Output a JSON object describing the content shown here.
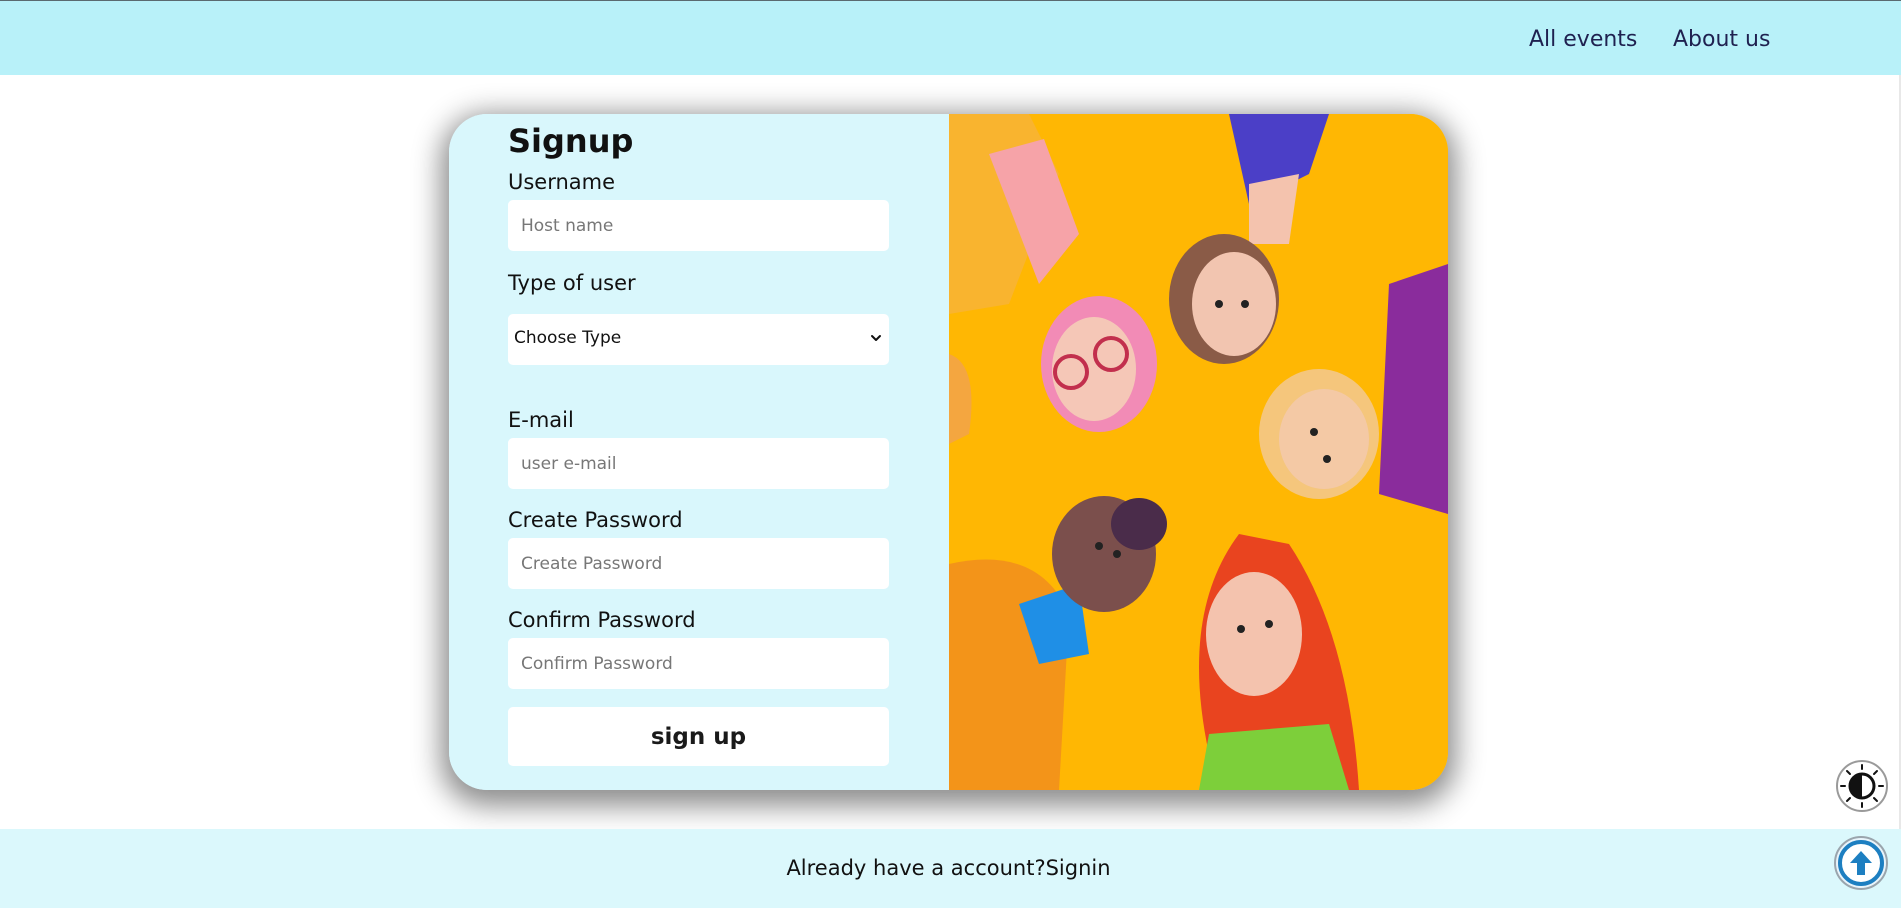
{
  "header": {
    "nav": [
      {
        "label": "All events"
      },
      {
        "label": "About us"
      }
    ]
  },
  "form": {
    "title": "Signup",
    "username": {
      "label": "Username",
      "placeholder": "Host name",
      "value": ""
    },
    "user_type": {
      "label": "Type of user",
      "selected": "Choose Type"
    },
    "email": {
      "label": "E-mail",
      "placeholder": "user e-mail",
      "value": ""
    },
    "create_password": {
      "label": "Create Password",
      "placeholder": "Create Password",
      "value": ""
    },
    "confirm_password": {
      "label": "Confirm Password",
      "placeholder": "Confirm Password",
      "value": ""
    },
    "submit_label": "sign up"
  },
  "illustration": {
    "description_icon": "people-circle-illustration",
    "background_color": "#ffb703"
  },
  "footer": {
    "prompt": "Already have a account?",
    "link": "Signin"
  },
  "floating": {
    "contrast_icon": "contrast-icon",
    "scroll_icon": "arrow-up-circle-icon"
  },
  "colors": {
    "header_bg": "#b8f1f9",
    "form_bg": "#d9f7fc",
    "footer_bg": "#dbf8fc",
    "nav_text": "#1f2150"
  }
}
